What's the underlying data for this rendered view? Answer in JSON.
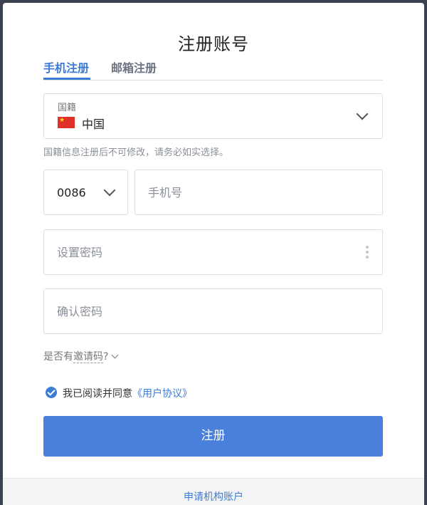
{
  "page": {
    "title": "注册账号"
  },
  "tabs": [
    {
      "label": "手机注册",
      "active": true
    },
    {
      "label": "邮箱注册",
      "active": false
    }
  ],
  "nationality": {
    "label": "国籍",
    "value": "中国",
    "flag_icon": "china-flag-icon",
    "hint": "国籍信息注册后不可修改，请务必如实选择。"
  },
  "phone": {
    "country_code": "0086",
    "placeholder": "手机号",
    "value": ""
  },
  "password": {
    "placeholder": "设置密码",
    "value": ""
  },
  "confirm_password": {
    "placeholder": "确认密码",
    "value": ""
  },
  "invite": {
    "prefix": "是否有",
    "link": "邀请码",
    "suffix": "?"
  },
  "agreement": {
    "checked": true,
    "text": "我已阅读并同意",
    "link": "《用户协议》"
  },
  "submit_label": "注册",
  "footer": {
    "link": "申请机构账户"
  },
  "colors": {
    "accent": "#3c7bd6",
    "button": "#4a7fdb",
    "backdrop": "#3a4250"
  }
}
